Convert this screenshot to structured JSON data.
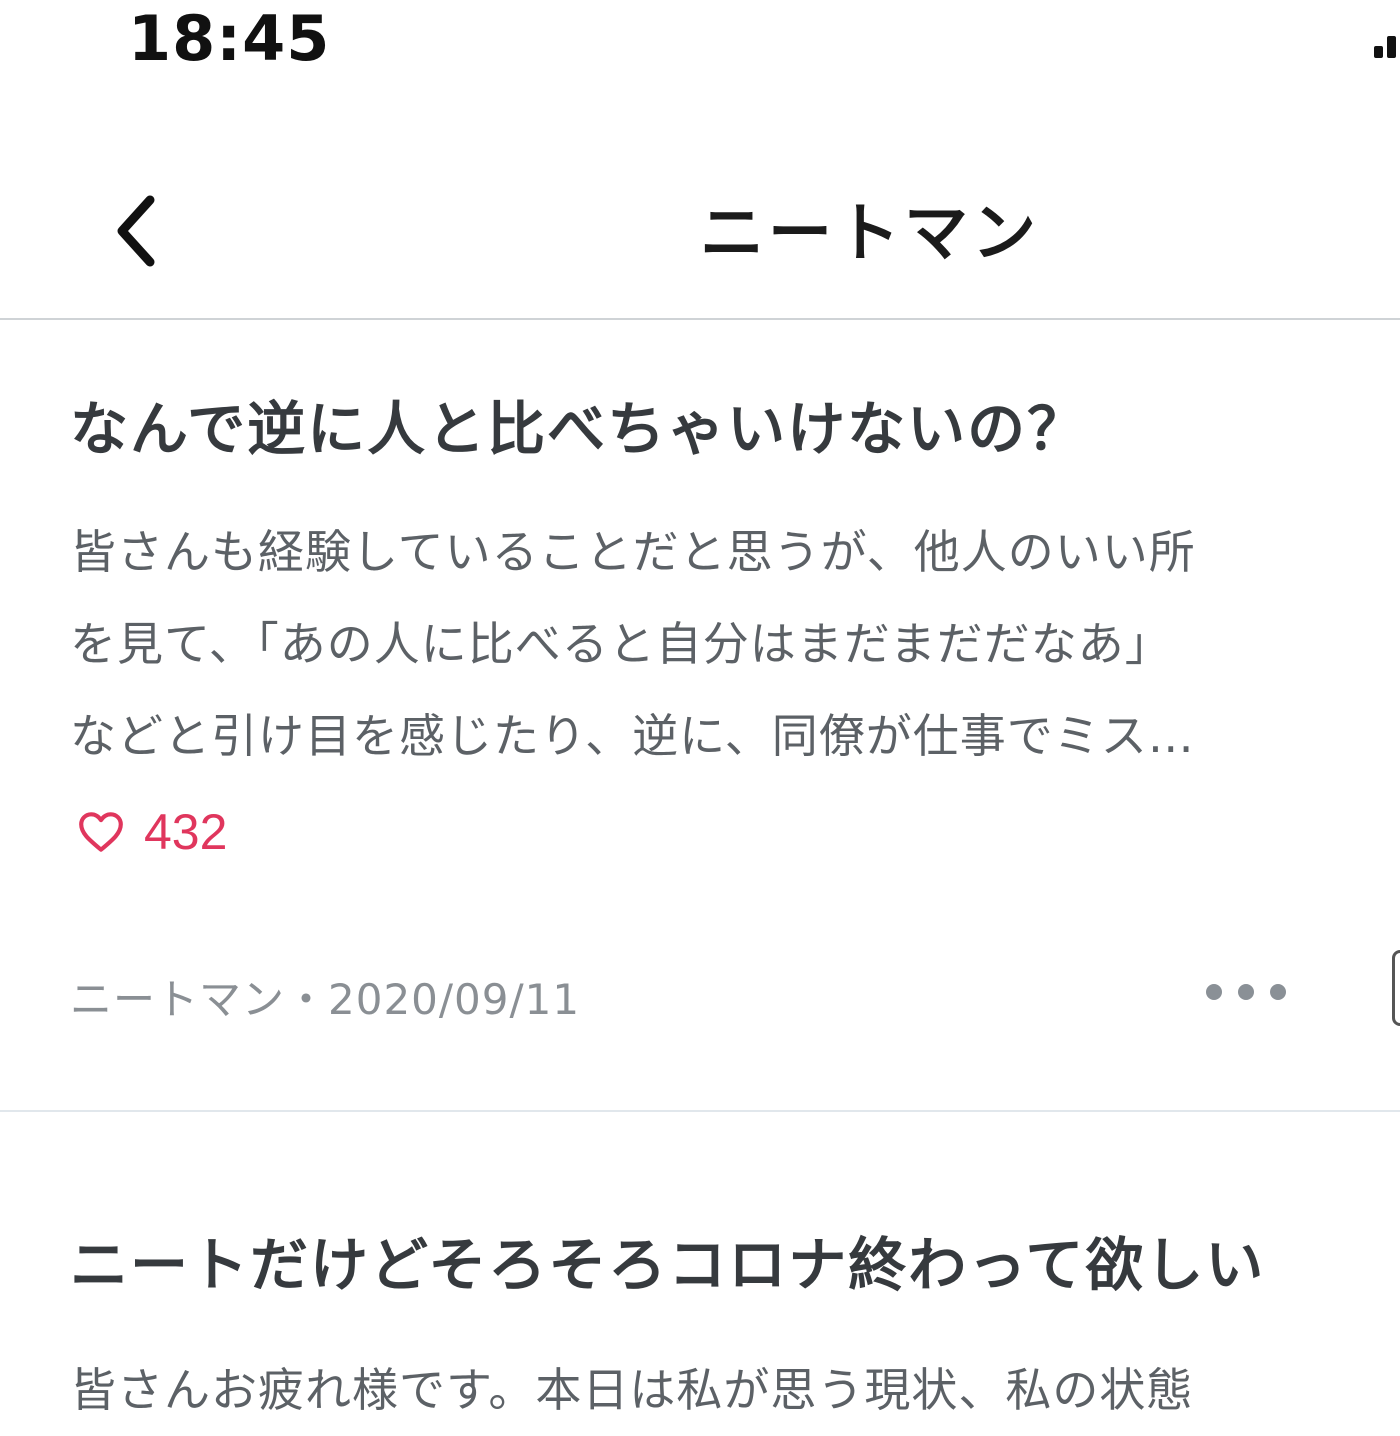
{
  "status_bar": {
    "time": "18:45"
  },
  "nav": {
    "back_icon": "chevron-left-icon",
    "title": "ニートマン"
  },
  "articles": [
    {
      "title": "なんで逆に人と比べちゃいけないの？",
      "excerpt_lines": [
        "皆さんも経験していることだと思うが、他人のいい所",
        "を見て、「あの人に比べると自分はまだまだだなあ」",
        "などと引け目を感じたり、逆に、同僚が仕事でミス…"
      ],
      "like_icon": "heart-outline-icon",
      "likes": "432",
      "meta": "ニートマン・2020/09/11",
      "more_icon": "ellipsis-icon"
    },
    {
      "title": "ニートだけどそろそろコロナ終わって欲しい",
      "excerpt_lines": [
        "皆さんお疲れ様です。本日は私が思う現状、私の状態"
      ]
    }
  ],
  "colors": {
    "accent_like": "#e0365d",
    "text_primary": "#363a3e",
    "text_secondary": "#5c6166",
    "text_meta": "#8a8f94",
    "divider": "#cfd3d6"
  }
}
